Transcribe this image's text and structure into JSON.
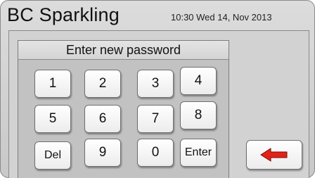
{
  "header": {
    "title": "BC Sparkling",
    "datetime": "10:30 Wed 14, Nov 2013"
  },
  "keypad": {
    "prompt": "Enter new password",
    "keys": {
      "k1": "1",
      "k2": "2",
      "k3": "3",
      "k4": "4",
      "k5": "5",
      "k6": "6",
      "k7": "7",
      "k8": "8",
      "del": "Del",
      "k9": "9",
      "k0": "0",
      "enter": "Enter"
    }
  },
  "back_button": {
    "icon": "back-arrow-icon",
    "color": "#e2231a"
  }
}
